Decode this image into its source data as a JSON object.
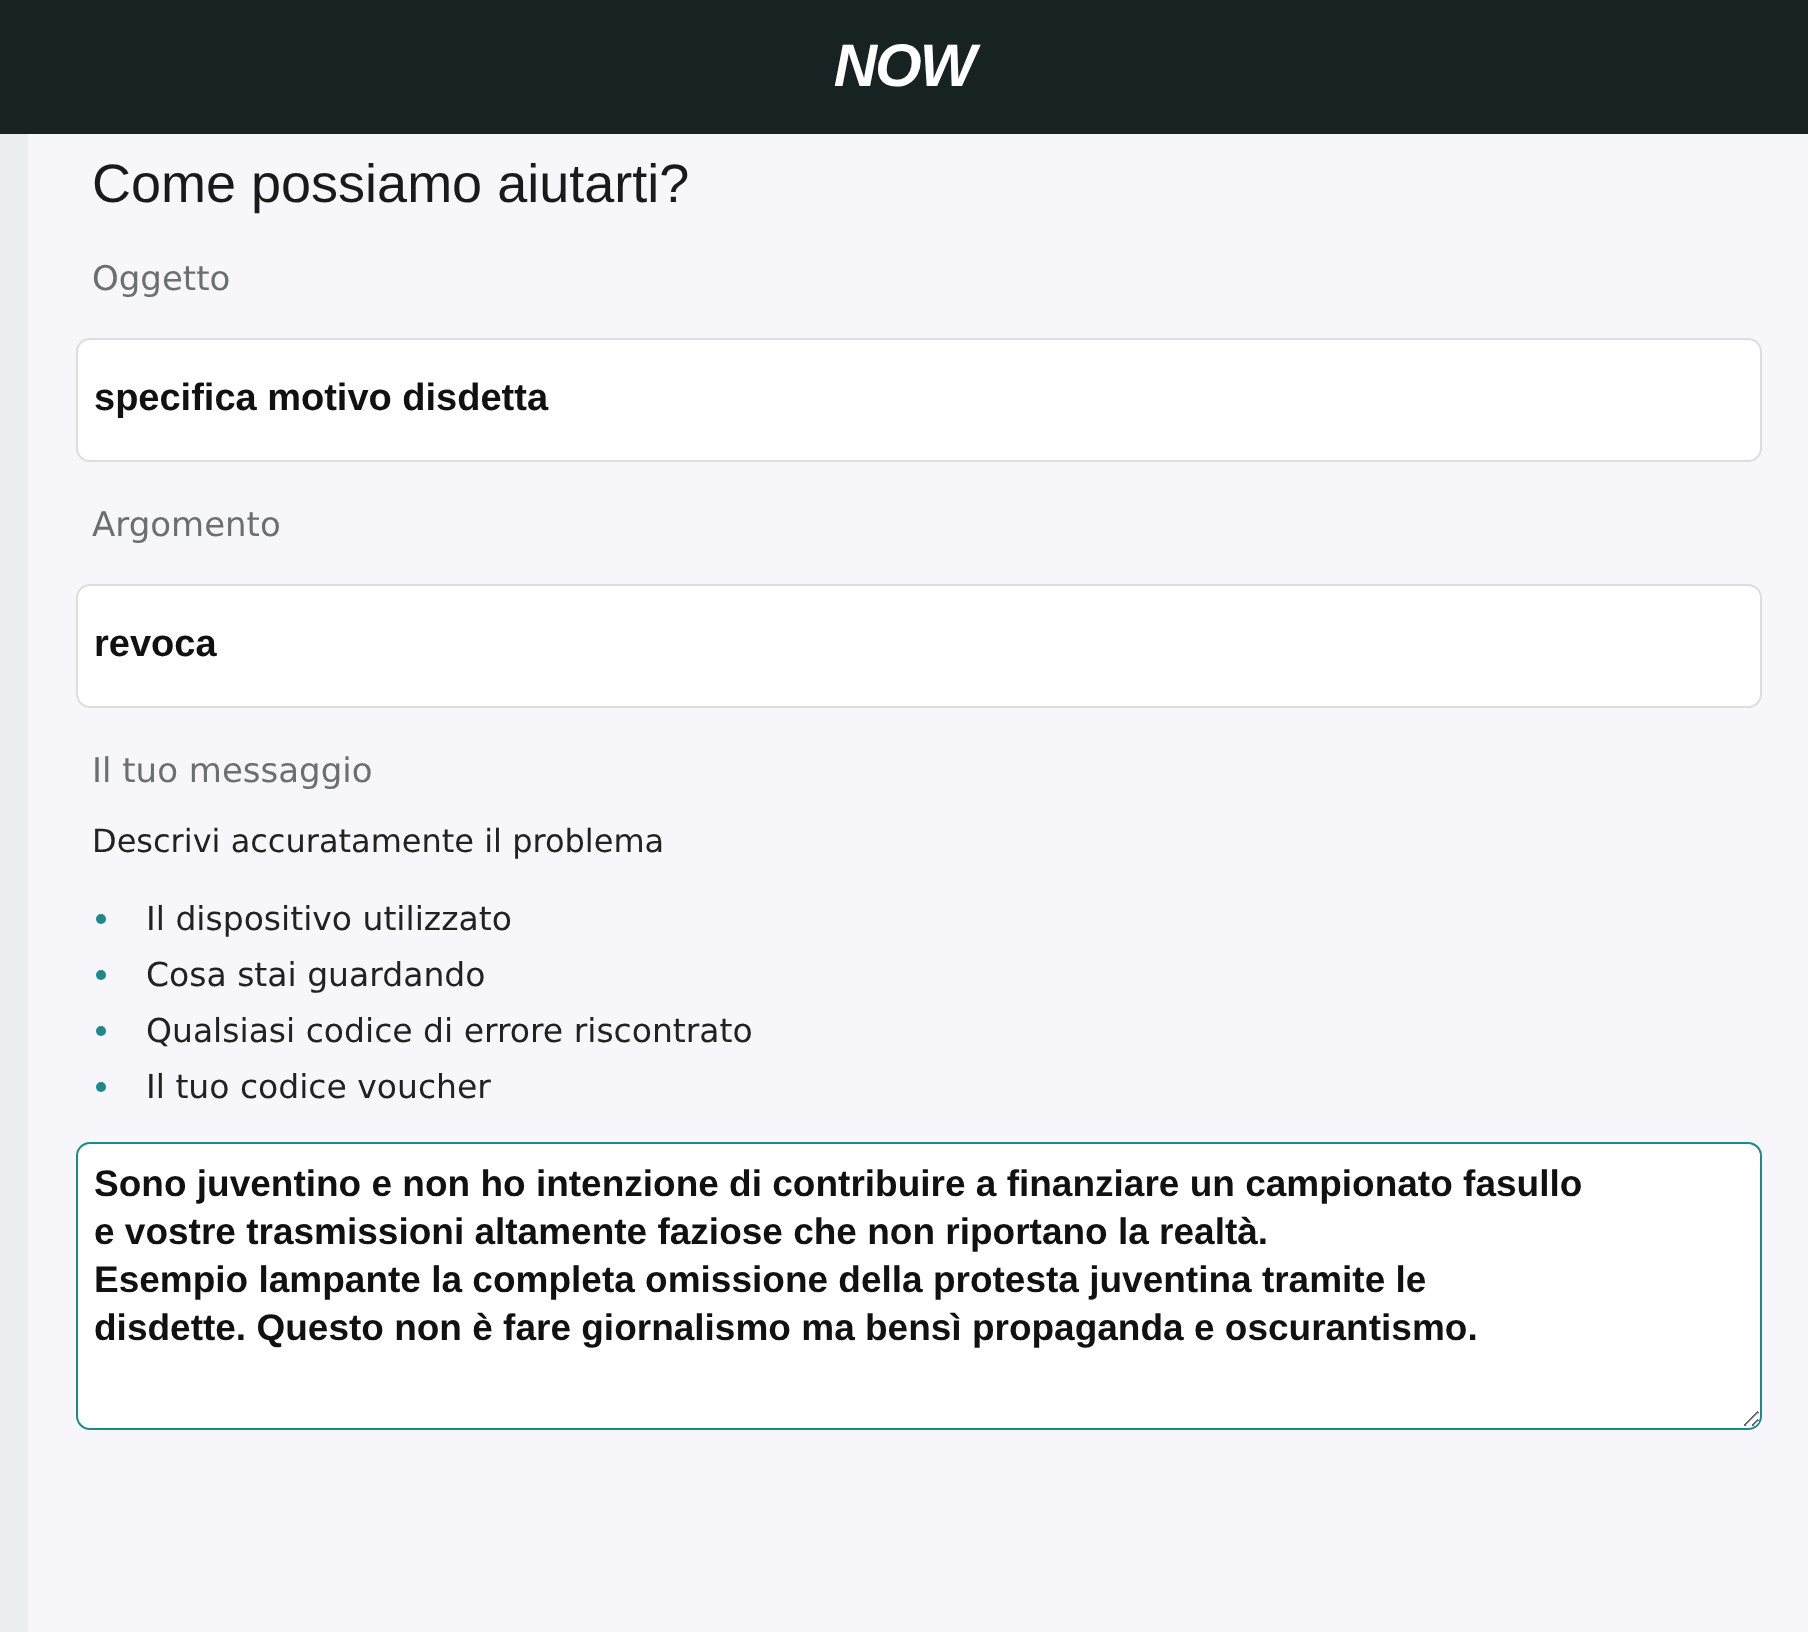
{
  "header": {
    "logo": "NOW"
  },
  "title": "Come possiamo aiutarti?",
  "fields": [
    {
      "label": "Oggetto",
      "value": "specifica motivo disdetta"
    },
    {
      "label": "Argomento",
      "value": "revoca"
    }
  ],
  "message": {
    "label": "Il tuo messaggio",
    "intro": "Descrivi accuratamente il problema",
    "bullets": [
      "Il dispositivo utilizzato",
      "Cosa stai guardando",
      "Qualsiasi codice di errore riscontrato",
      "Il tuo codice voucher"
    ],
    "value": "Sono juventino e non ho intenzione di contribuire a finanziare un campionato fasullo\ne vostre trasmissioni altamente faziose che non riportano la realtà.\nEsempio lampante la completa omissione della protesta juventina tramite le\ndisdette. Questo non è fare giornalismo ma bensì propaganda e oscurantismo."
  }
}
